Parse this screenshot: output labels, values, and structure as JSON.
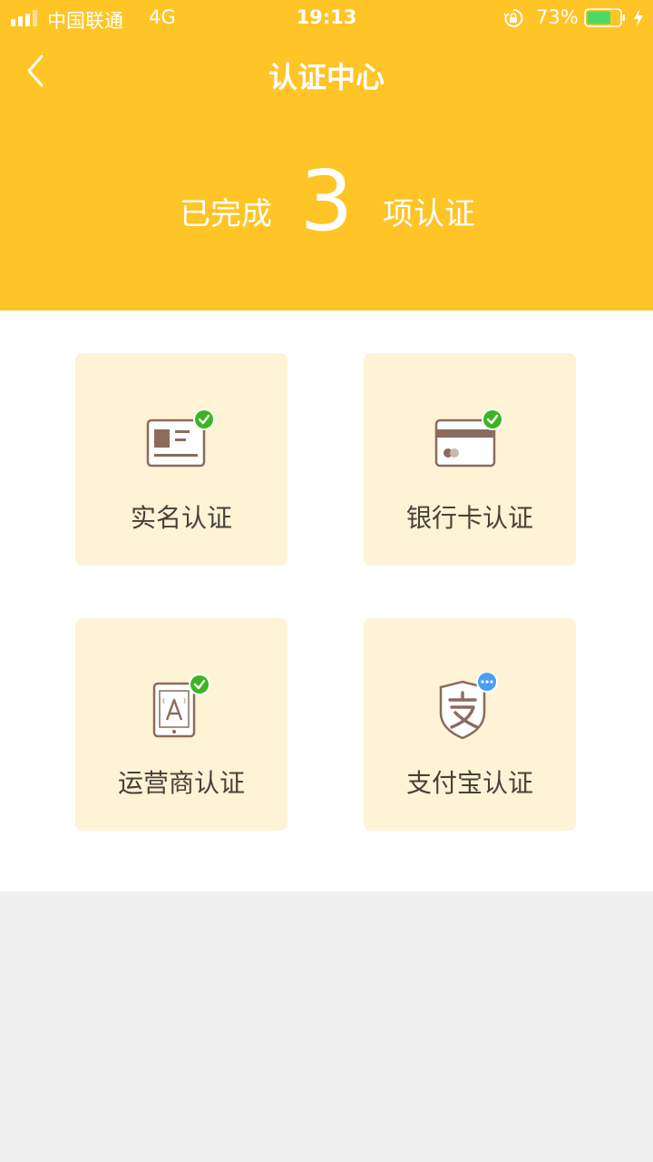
{
  "status_bar": {
    "carrier": "中国联通",
    "network": "4G",
    "time": "19:13",
    "battery_percent": "73%",
    "battery_level": 0.73,
    "icons": [
      "signal-icon",
      "rotation-lock-icon",
      "battery-icon",
      "charging-bolt-icon"
    ]
  },
  "nav": {
    "title": "认证中心",
    "back_icon": "chevron-left-icon"
  },
  "summary": {
    "prefix": "已完成",
    "count": "3",
    "suffix": "项认证"
  },
  "cards": [
    {
      "label": "实名认证",
      "icon": "id-card-icon",
      "status": "verified",
      "status_icon": "check-badge-icon"
    },
    {
      "label": "银行卡认证",
      "icon": "bank-card-icon",
      "status": "verified",
      "status_icon": "check-badge-icon"
    },
    {
      "label": "运营商认证",
      "icon": "phone-carrier-icon",
      "status": "verified",
      "status_icon": "check-badge-icon"
    },
    {
      "label": "支付宝认证",
      "icon": "alipay-shield-icon",
      "status": "pending",
      "status_icon": "more-badge-icon"
    }
  ],
  "colors": {
    "header_bg": "#FFC426",
    "card_bg": "#FFF3D6",
    "icon_brown": "#8B6B5C",
    "verified_green": "#3CB521",
    "pending_blue": "#4A9EF5",
    "page_bg": "#F0F0F0"
  }
}
